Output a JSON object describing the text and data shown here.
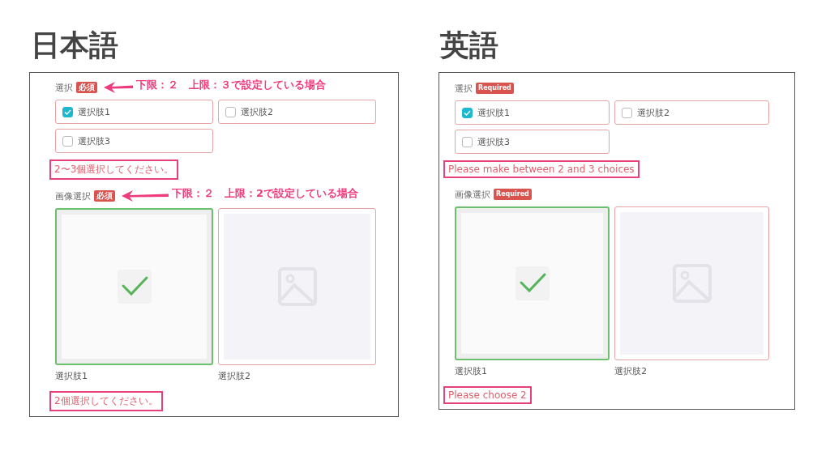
{
  "sections": [
    {
      "heading": "日本語",
      "fields": [
        {
          "kind": "checkbox",
          "label": "選択",
          "badge": "必須",
          "annotation": "下限：２　上限：３で設定している場合",
          "options": [
            {
              "label": "選択肢1",
              "checked": true
            },
            {
              "label": "選択肢2",
              "checked": false
            },
            {
              "label": "選択肢3",
              "checked": false
            }
          ],
          "error": "2〜3個選択してください。"
        },
        {
          "kind": "image",
          "label": "画像選択",
          "badge": "必須",
          "annotation": "下限：２　上限：2で設定している場合",
          "options": [
            {
              "label": "選択肢1",
              "selected": true
            },
            {
              "label": "選択肢2",
              "selected": false
            }
          ],
          "error": "2個選択してください。"
        }
      ]
    },
    {
      "heading": "英語",
      "fields": [
        {
          "kind": "checkbox",
          "label": "選択",
          "badge": "Required",
          "options": [
            {
              "label": "選択肢1",
              "checked": true
            },
            {
              "label": "選択肢2",
              "checked": false
            },
            {
              "label": "選択肢3",
              "checked": false
            }
          ],
          "error": "Please make between 2 and 3 choices"
        },
        {
          "kind": "image",
          "label": "画像選択",
          "badge": "Required",
          "options": [
            {
              "label": "選択肢1",
              "selected": true
            },
            {
              "label": "選択肢2",
              "selected": false
            }
          ],
          "error": "Please choose 2"
        }
      ]
    }
  ]
}
